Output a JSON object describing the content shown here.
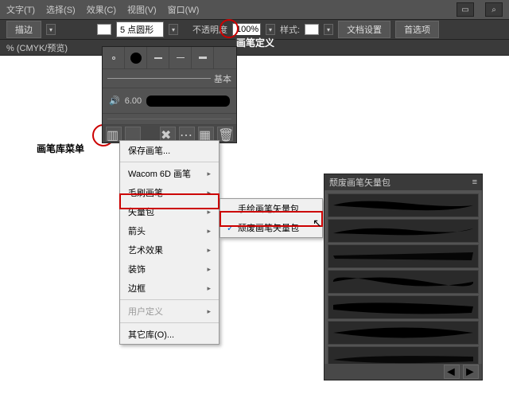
{
  "menubar": {
    "items": [
      "文字(T)",
      "选择(S)",
      "效果(C)",
      "视图(V)",
      "窗口(W)"
    ]
  },
  "toolbar": {
    "stroke_label": "描边",
    "weight_label": "5 点圆形",
    "opacity_label": "不透明度",
    "opacity_value": "100%",
    "style_label": "样式:",
    "docsetup": "文档设置",
    "prefs": "首选项"
  },
  "status": "% (CMYK/预览)",
  "brush_panel": {
    "basic_label": "基本",
    "size_value": "6.00"
  },
  "callouts": {
    "brush_def": "画笔定义",
    "brush_lib_menu": "画笔库菜单"
  },
  "context_menu": {
    "items": [
      {
        "label": "保存画笔...",
        "sub": false,
        "disabled": false
      },
      {
        "sep": true
      },
      {
        "label": "Wacom 6D 画笔",
        "sub": true
      },
      {
        "label": "毛刷画笔",
        "sub": true
      },
      {
        "label": "矢量包",
        "sub": true,
        "hl": true
      },
      {
        "label": "箭头",
        "sub": true
      },
      {
        "label": "艺术效果",
        "sub": true
      },
      {
        "label": "装饰",
        "sub": true
      },
      {
        "label": "边框",
        "sub": true
      },
      {
        "sep": true
      },
      {
        "label": "用户定义",
        "sub": true,
        "disabled": true
      },
      {
        "sep": true
      },
      {
        "label": "其它库(O)...",
        "sub": false
      }
    ]
  },
  "submenu": {
    "items": [
      {
        "label": "手绘画笔矢量包",
        "checked": false
      },
      {
        "label": "颓废画笔矢量包",
        "checked": true,
        "hl": true
      }
    ]
  },
  "brush_lib": {
    "title": "颓废画笔矢量包",
    "count": 7
  }
}
